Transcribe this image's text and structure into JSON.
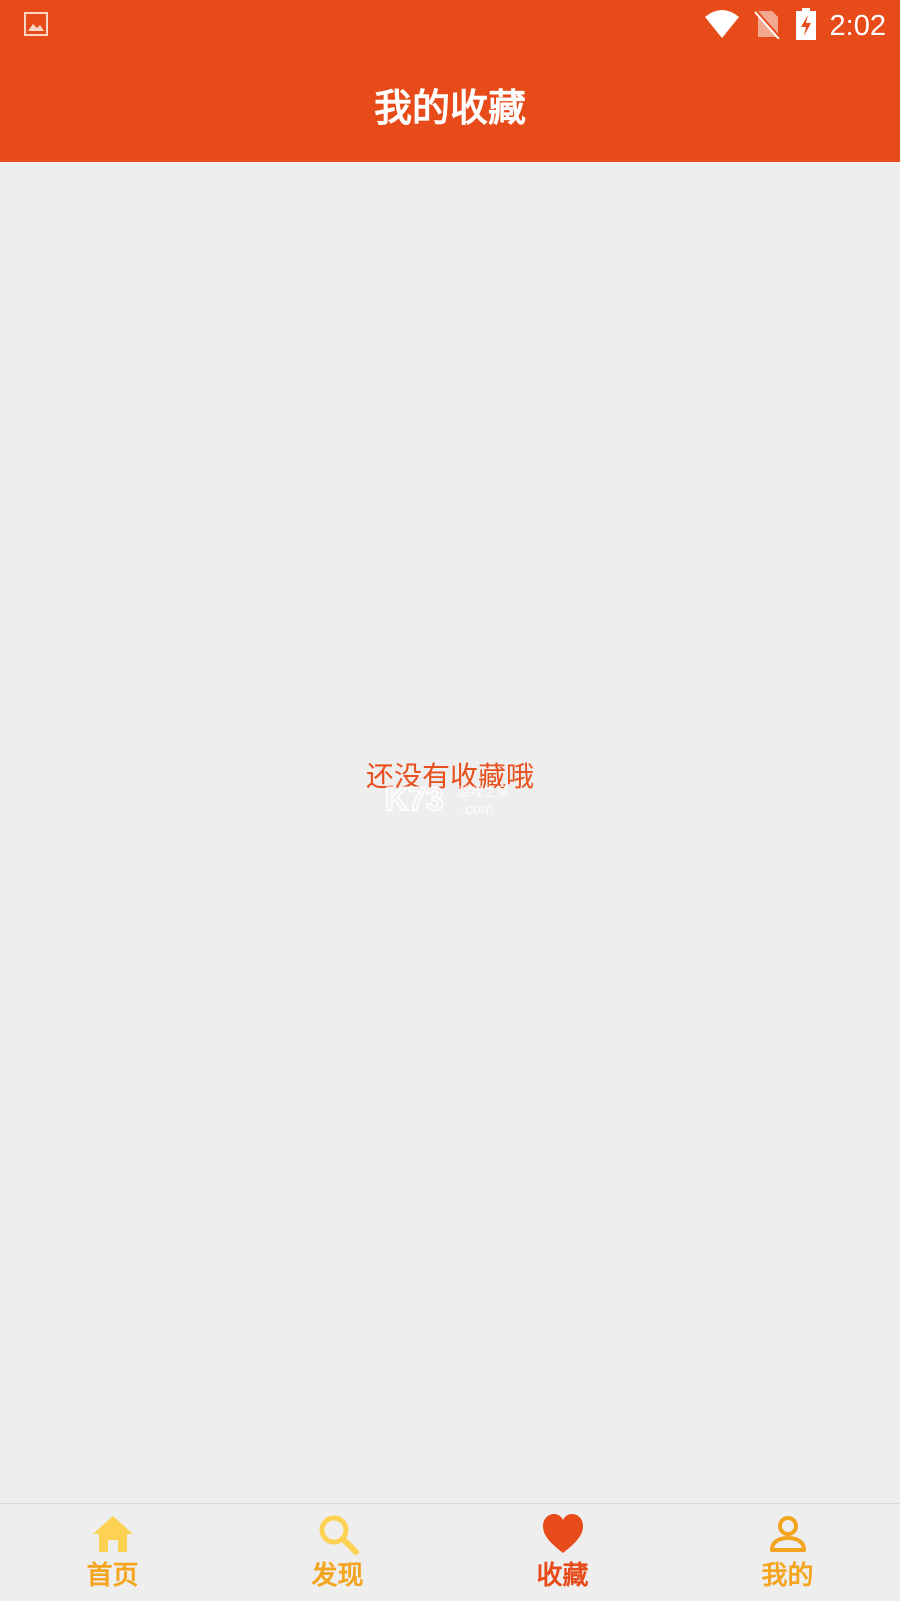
{
  "status_bar": {
    "time": "2:02",
    "icons": [
      "image-icon",
      "wifi-icon",
      "no-sim-icon",
      "battery-charging-icon"
    ]
  },
  "header": {
    "title": "我的收藏"
  },
  "main": {
    "empty_message": "还没有收藏哦",
    "watermark": {
      "brand": "K73",
      "tagline": "游戏之家",
      "domain": ".com"
    }
  },
  "tabbar": {
    "tabs": [
      {
        "label": "首页",
        "icon": "home-icon",
        "active": false
      },
      {
        "label": "发现",
        "icon": "search-icon",
        "active": false
      },
      {
        "label": "收藏",
        "icon": "heart-icon",
        "active": true
      },
      {
        "label": "我的",
        "icon": "person-icon",
        "active": false
      }
    ]
  },
  "colors": {
    "accent": "#e84b1a",
    "tab_inactive": "#f4a51f",
    "background": "#eeeeef"
  }
}
